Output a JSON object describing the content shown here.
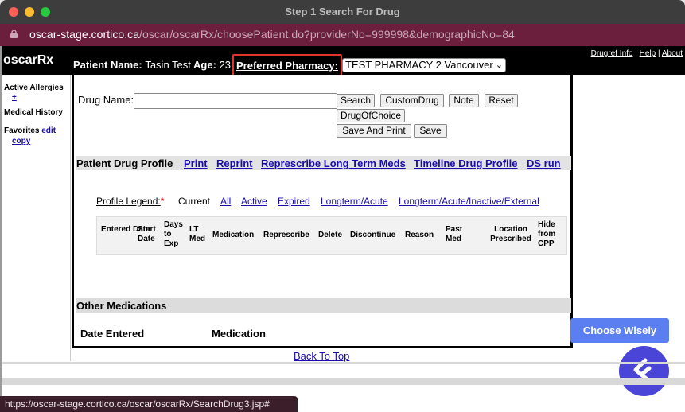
{
  "window": {
    "title": "Step 1 Search For Drug"
  },
  "urlbar": {
    "host": "oscar-stage.cortico.ca",
    "path": "/oscar/oscarRx/choosePatient.do?providerNo=999998&demographicNo=84"
  },
  "header": {
    "logo": "oscarRx",
    "patient_label": "Patient Name:",
    "patient_name": "Tasin Test",
    "age_label": "Age:",
    "age_value": "23",
    "pharmacy_label": "Preferred Pharmacy:",
    "pharmacy_selected": "TEST PHARMACY 2 Vancouver",
    "links": [
      "Drugref Info",
      "Help",
      "About"
    ],
    "link_separator": "|"
  },
  "leftnav": {
    "allergies_label": "Active Allergies",
    "allergies_add": "+",
    "medical_history": "Medical History",
    "favorites_label": "Favorites",
    "favorites_edit": "edit",
    "favorites_copy": "copy"
  },
  "search": {
    "drug_name_label": "Drug Name:",
    "drug_input_value": "",
    "buttons": {
      "search": "Search",
      "custom_drug": "CustomDrug",
      "note": "Note",
      "reset": "Reset",
      "drug_of_choice": "DrugOfChoice",
      "save_and_print": "Save And Print",
      "save": "Save"
    }
  },
  "profile": {
    "title": "Patient Drug Profile",
    "links": [
      "Print",
      "Reprint",
      "Represcribe Long Term Meds",
      "Timeline Drug Profile",
      "DS run"
    ],
    "legend_label": "Profile Legend:",
    "legend_star": "*",
    "legend_current": "Current",
    "legend_links": [
      "All",
      "Active",
      "Expired",
      "Longterm/Acute",
      "Longterm/Acute/Inactive/External"
    ],
    "columns": [
      "Entered Date",
      "Start Date",
      "Days to Exp",
      "LT Med",
      "Medication",
      "Represcribe",
      "Delete",
      "Discontinue",
      "Reason",
      "Past Med",
      "Location Prescribed",
      "Hide from CPP"
    ]
  },
  "other_meds": {
    "title": "Other Medications",
    "col_date": "Date Entered",
    "col_med": "Medication"
  },
  "footer": {
    "back_to_top": "Back To Top",
    "choose_wisely": "Choose Wisely",
    "status_url": "https://oscar-stage.cortico.ca/oscar/oscarRx/SearchDrug3.jsp#"
  },
  "colors": {
    "url_bar": "#6b1f3c",
    "highlight_box": "#e0352b",
    "choose_wisely": "#5b7ff0",
    "fab": "#4a45d6",
    "link": "#1a0dab"
  }
}
